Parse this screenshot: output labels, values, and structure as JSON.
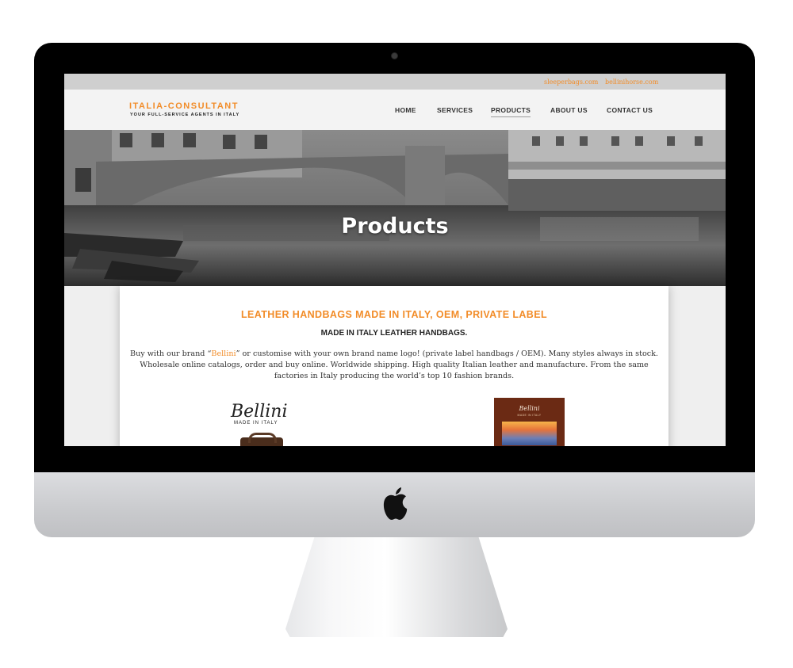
{
  "topbar": {
    "links": [
      "sleeperbags.com",
      "bellinihorse.com"
    ]
  },
  "logo": {
    "title": "ITALIA-CONSULTANT",
    "subtitle": "YOUR FULL-SERVICE AGENTS IN ITALY"
  },
  "nav": {
    "items": [
      "HOME",
      "SERVICES",
      "PRODUCTS",
      "ABOUT US",
      "CONTACT US"
    ],
    "active": "PRODUCTS"
  },
  "hero": {
    "title": "Products"
  },
  "content": {
    "heading": "LEATHER HANDBAGS MADE IN ITALY, OEM, PRIVATE LABEL",
    "subheading": "MADE IN ITALY LEATHER HANDBAGS.",
    "body_pre": "Buy with our brand “",
    "brand_link": "Bellini",
    "body_post": "” or customise with your own brand name logo! (private label handbags / OEM). Many styles always in stock. Wholesale online catalogs, order and buy online. Worldwide shipping. High quality Italian leather and manufacture. From the same factories in Italy producing the world’s top 10 fashion brands."
  },
  "bellini": {
    "name": "Bellini",
    "tagline": "MADE IN ITALY"
  },
  "catalog": {
    "brand": "Bellini",
    "subtitle": "MADE IN ITALY"
  },
  "colors": {
    "accent": "#f28c28",
    "bezel": "#000000",
    "page_bg": "#efefef"
  },
  "icons": [
    "apple-logo-icon",
    "camera-icon"
  ]
}
